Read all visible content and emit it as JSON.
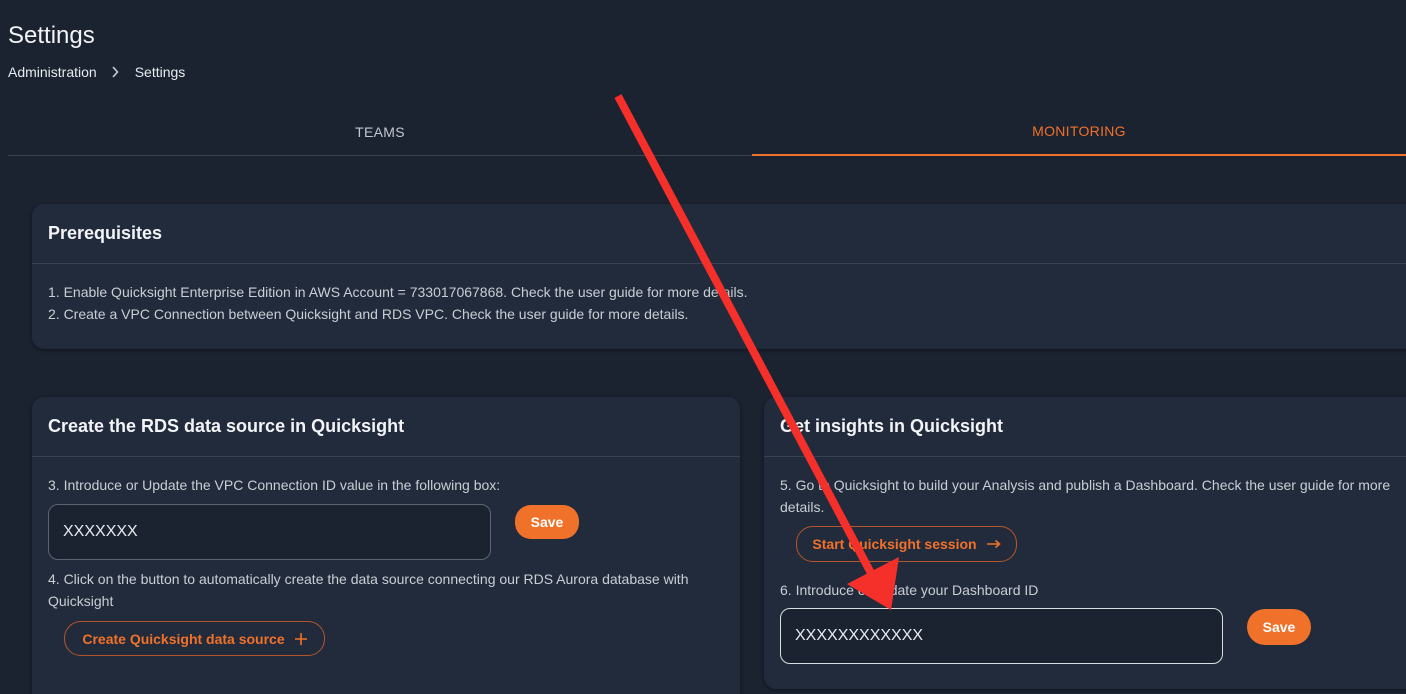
{
  "header": {
    "title": "Settings",
    "breadcrumb": [
      "Administration",
      "Settings"
    ]
  },
  "tabs": [
    {
      "label": "TEAMS",
      "active": false
    },
    {
      "label": "MONITORING",
      "active": true
    }
  ],
  "prerequisites": {
    "title": "Prerequisites",
    "steps": [
      "1. Enable Quicksight Enterprise Edition in AWS Account = 733017067868. Check the user guide for more details.",
      "2. Create a VPC Connection between Quicksight and RDS VPC. Check the user guide for more details."
    ]
  },
  "rds_card": {
    "title": "Create the RDS data source in Quicksight",
    "step3": "3. Introduce or Update the VPC Connection ID value in the following box:",
    "vpc_input_value": "XXXXXXX",
    "save_label": "Save",
    "step4": "4. Click on the button to automatically create the data source connecting our RDS Aurora database with Quicksight",
    "create_button_label": "Create Quicksight data source"
  },
  "insights_card": {
    "title": "Get insights in Quicksight",
    "step5": "5. Go to Quicksight to build your Analysis and publish a Dashboard. Check the user guide for more details.",
    "start_button_label": "Start Quicksight session",
    "step6": "6. Introduce or update your Dashboard ID",
    "dashboard_input_value": "XXXXXXXXXXXX",
    "save_label": "Save"
  },
  "colors": {
    "background": "#1b2230",
    "card": "#222b3b",
    "accent": "#f0722a",
    "annotation_arrow": "#f5302a"
  },
  "icons": {
    "breadcrumb_separator": "chevron-right-icon",
    "create_button": "plus-icon",
    "start_button": "arrow-right-icon"
  }
}
